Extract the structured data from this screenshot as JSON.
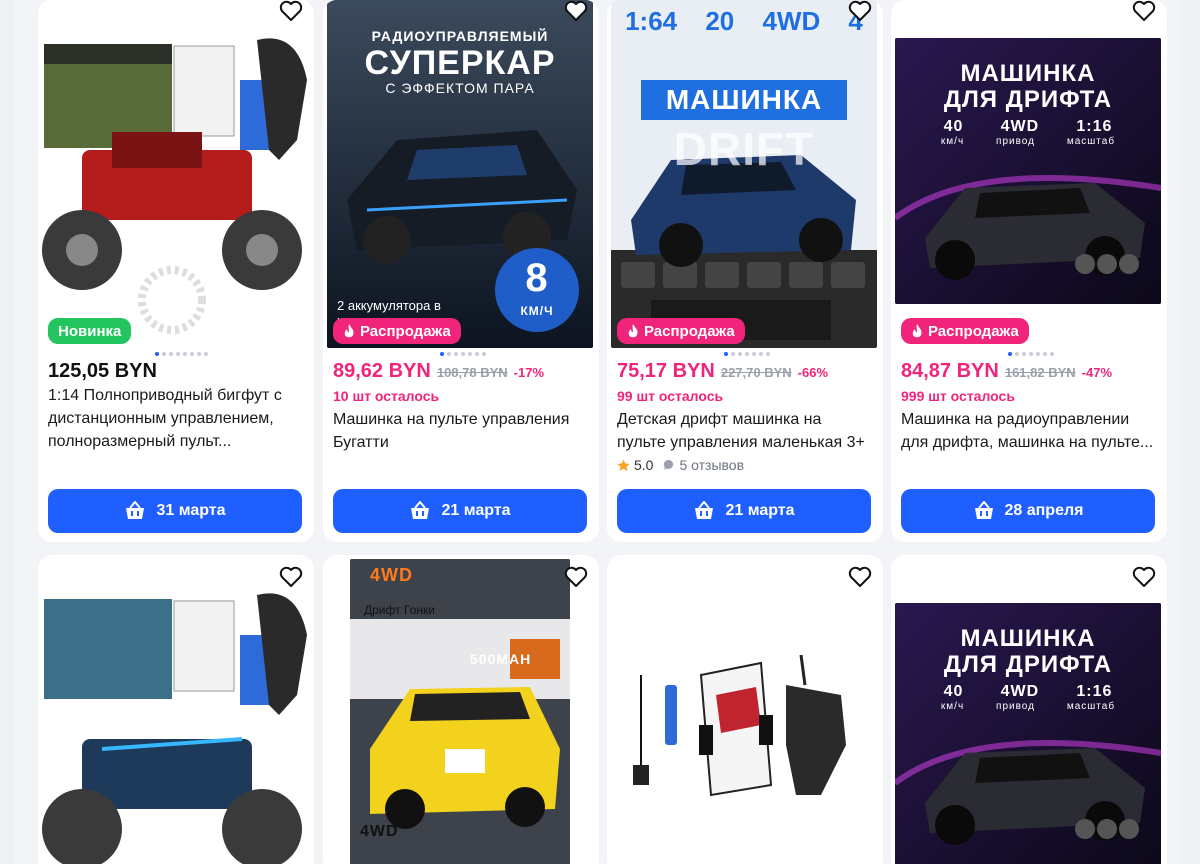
{
  "cards": [
    {
      "badge": "Новинка",
      "price": "125,05 BYN",
      "old_price": "",
      "discount": "",
      "left": "",
      "title": "1:14 Полноприводный бигфут с дистанционным управлением, полноразмерный пульт...",
      "rating": "",
      "reviews": "",
      "delivery": "31 марта"
    },
    {
      "badge": "Распродажа",
      "price": "89,62 BYN",
      "old_price": "108,78 BYN",
      "discount": "-17%",
      "left": "10 шт осталось",
      "title": "Машинка на пульте управления Бугатти",
      "rating": "",
      "reviews": "",
      "delivery": "21 марта",
      "img_text": {
        "t1": "РАДИОУПРАВЛЯЕМЫЙ",
        "t2": "СУПЕРКАР",
        "t3": "С ЭФФЕКТОМ ПАРА",
        "t4": "2 аккумулятора в комплекте",
        "speed": "8",
        "speed_unit": "КМ/Ч"
      }
    },
    {
      "badge": "Распродажа",
      "price": "75,17 BYN",
      "old_price": "227,70 BYN",
      "discount": "-66%",
      "left": "99 шт осталось",
      "title": "Детская дрифт машинка на пульте управления маленькая 3+",
      "rating": "5.0",
      "reviews": "5 отзывов",
      "delivery": "21 марта",
      "img_text": {
        "t1": "1:64",
        "t2": "20",
        "t3": "4WD",
        "t4": "4",
        "t5": "МАШИНКА",
        "t6": "DRIFT"
      }
    },
    {
      "badge": "Распродажа",
      "price": "84,87 BYN",
      "old_price": "161,82 BYN",
      "discount": "-47%",
      "left": "999 шт осталось",
      "title": "Машинка на радиоуправлении для дрифта, машинка на пульте...",
      "rating": "",
      "reviews": "",
      "delivery": "28 апреля",
      "img_text": {
        "t1": "МАШИНКА",
        "t2": "ДЛЯ ДРИФТА",
        "s1": "40",
        "s2": "4WD",
        "s3": "1:16",
        "l1": "км/ч",
        "l2": "привод",
        "l3": "масштаб"
      }
    }
  ],
  "row2": [
    {
      "name": "monster-truck-blue"
    },
    {
      "name": "drift-van",
      "img_text": {
        "brand": "4WD",
        "t1": "Дрифт Гонки",
        "t2": "500MAH",
        "t3": "4WD"
      }
    },
    {
      "name": "rc-car-white"
    },
    {
      "name": "drift-bmw",
      "img_text": {
        "t1": "МАШИНКА",
        "t2": "ДЛЯ ДРИФТА",
        "s1": "40",
        "s2": "4WD",
        "s3": "1:16",
        "l1": "км/ч",
        "l2": "привод",
        "l3": "масштаб"
      }
    }
  ]
}
